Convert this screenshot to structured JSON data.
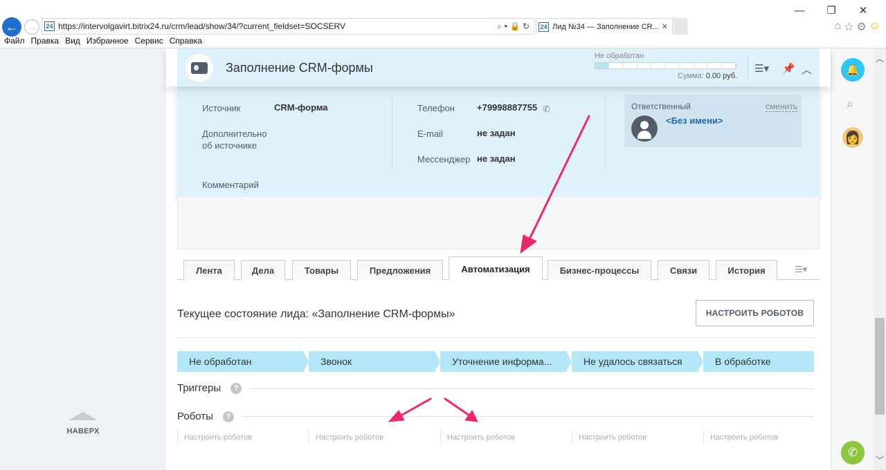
{
  "browser": {
    "window_controls": [
      "—",
      "❐",
      "✕"
    ],
    "url": "https://intervolgavirt.bitrix24.ru/crm/lead/show/34/?current_fieldset=SOCSERV",
    "address_tools": "⌕ ▾ 🔒 ↻",
    "tab_title": "Лид №34 — Заполнение CR...",
    "tab_close": "✕",
    "favicon": "24",
    "menu": [
      "Файл",
      "Правка",
      "Вид",
      "Избранное",
      "Сервис",
      "Справка"
    ]
  },
  "left_panel": {
    "to_top_label": "НАВЕРХ"
  },
  "lead_header": {
    "title": "Заполнение CRM-формы",
    "stage_label": "Не обработан",
    "stage_progress_segments": 10,
    "stage_progress_filled": 1,
    "sum_label": "Сумма:",
    "sum_value": "0.00 руб.",
    "icons": [
      "list-settings-icon",
      "pin-icon",
      "collapse-icon"
    ]
  },
  "details": {
    "source_label": "Источник",
    "source_value": "CRM-форма",
    "extra_source_label_1": "Дополнительно",
    "extra_source_label_2": "об источнике",
    "comment_label": "Комментарий",
    "phone_label": "Телефон",
    "phone_value": "+79998887755",
    "email_label": "E-mail",
    "email_value": "не задан",
    "messenger_label": "Мессенджер",
    "messenger_value": "не задан",
    "responsible_label": "Ответственный",
    "responsible_change": "сменить",
    "responsible_name": "<Без имени>"
  },
  "tabs": [
    {
      "label": "Лента",
      "active": false
    },
    {
      "label": "Дела",
      "active": false
    },
    {
      "label": "Товары",
      "active": false
    },
    {
      "label": "Предложения",
      "active": false
    },
    {
      "label": "Автоматизация",
      "active": true
    },
    {
      "label": "Бизнес-процессы",
      "active": false
    },
    {
      "label": "Связи",
      "active": false
    },
    {
      "label": "История",
      "active": false
    }
  ],
  "tabs_more": "☰▾",
  "automation": {
    "current_state": "Текущее состояние лида: «Заполнение CRM-формы»",
    "configure_button": "НАСТРОИТЬ РОБОТОВ",
    "stages": [
      "Не обработан",
      "Звонок",
      "Уточнение информа...",
      "Не удалось связаться",
      "В обработке"
    ],
    "triggers_label": "Триггеры",
    "robots_label": "Роботы",
    "help_glyph": "?",
    "configure_robots_link": "Настроить роботов"
  },
  "colors": {
    "header_bg": "#dff1fb",
    "stage_bg": "#b3e6f7",
    "annotation": "#f0266a",
    "bell": "#2fc6f6",
    "phone": "#8bc63b"
  }
}
